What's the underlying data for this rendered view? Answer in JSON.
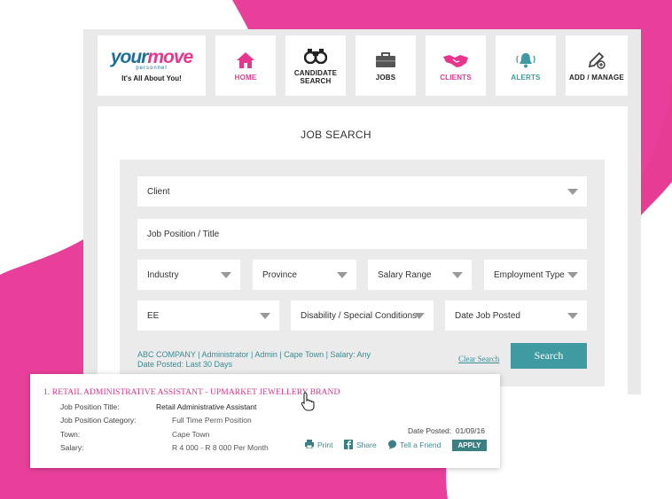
{
  "colors": {
    "accent_pink": "#e8368f",
    "accent_teal": "#3f9aa1",
    "frame_grey": "#e9e9e9"
  },
  "logo": {
    "word_part1": "your",
    "word_part2": "move",
    "sub": "personnel",
    "tagline": "It's All About You!"
  },
  "nav": [
    {
      "label": "HOME",
      "icon": "home-icon",
      "color": "#e8368f"
    },
    {
      "label": "CANDIDATE\nSEARCH",
      "icon": "binoculars-icon",
      "color": "#222222"
    },
    {
      "label": "JOBS",
      "icon": "briefcase-icon",
      "color": "#222222"
    },
    {
      "label": "CLIENTS",
      "icon": "handshake-icon",
      "color": "#e8368f"
    },
    {
      "label": "ALERTS",
      "icon": "bell-icon",
      "color": "#3f9aa1"
    },
    {
      "label": "ADD / MANAGE",
      "icon": "edit-add-icon",
      "color": "#222222"
    }
  ],
  "page_title": "JOB SEARCH",
  "form": {
    "client": "Client",
    "job_position": "Job Position / Title",
    "industry": "Industry",
    "province": "Province",
    "salary_range": "Salary Range",
    "employment_type": "Employment Type",
    "ee": "EE",
    "disability": "Disability / Special Conditions",
    "date_posted": "Date Job Posted"
  },
  "summary": {
    "line1": "ABC COMPANY | Administrator | Admin | Cape Town | Salary: Any",
    "line2": "Date Posted: Last 30 Days"
  },
  "clear_label": "Clear Search",
  "search_label": "Search",
  "result": {
    "title": "1.   RETAIL ADMINISTRATIVE ASSISTANT - UPMARKET JEWELLERY BRAND",
    "labels": {
      "position_title": "Job Position Title:",
      "category": "Job Position Category:",
      "town": "Town:",
      "salary": "Salary:"
    },
    "values": {
      "position_title": "Retail Administrative Assistant",
      "category": "Full Time Perm Position",
      "town": "Cape Town",
      "salary": "R 4 000 - R 8 000 Per Month"
    },
    "date_label": "Date Posted:",
    "date_value": "01/09/16",
    "print": "Print",
    "share": "Share",
    "tell": "Tell a Friend",
    "apply": "APPLY"
  }
}
